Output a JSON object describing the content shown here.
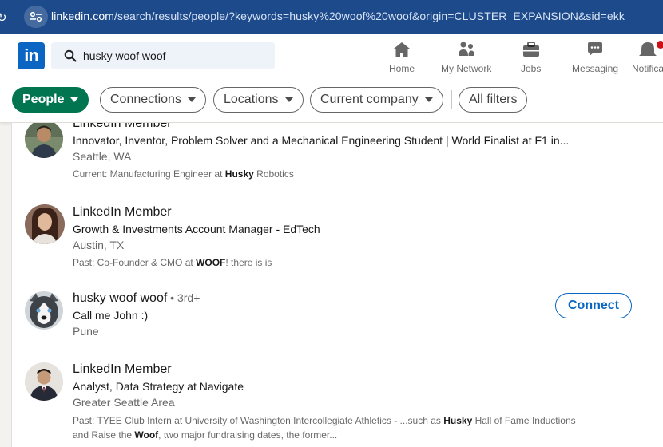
{
  "browser": {
    "url_host": "linkedin.com",
    "url_path": "/search/results/people/?keywords=husky%20woof%20woof&origin=CLUSTER_EXPANSION&sid=ekk"
  },
  "header": {
    "logo_text": "in",
    "search_value": "husky woof woof",
    "nav": [
      {
        "label": "Home",
        "icon": "home-icon"
      },
      {
        "label": "My Network",
        "icon": "network-icon"
      },
      {
        "label": "Jobs",
        "icon": "briefcase-icon"
      },
      {
        "label": "Messaging",
        "icon": "messaging-icon"
      },
      {
        "label": "Notifica",
        "icon": "bell-icon"
      }
    ]
  },
  "filters": [
    {
      "label": "People",
      "active": true
    },
    {
      "label": "Connections",
      "active": false
    },
    {
      "label": "Locations",
      "active": false
    },
    {
      "label": "Current company",
      "active": false
    },
    {
      "label": "All filters",
      "active": false
    }
  ],
  "results": [
    {
      "name": "LinkedIn Member",
      "headline": "Innovator, Inventor, Problem Solver and a Mechanical Engineering Student | World Finalist at F1 in...",
      "location": "Seattle, WA",
      "summary_prefix": "Current: Manufacturing Engineer at ",
      "summary_bold": "Husky",
      "summary_suffix": " Robotics"
    },
    {
      "name": "LinkedIn Member",
      "headline": "Growth & Investments Account Manager - EdTech",
      "location": "Austin, TX",
      "summary_prefix": "Past: Co-Founder & CMO at ",
      "summary_bold": "WOOF",
      "summary_suffix": "! there is is"
    },
    {
      "name": "husky woof woof",
      "degree": " • 3rd+",
      "headline": "Call me John :)",
      "location": "Pune",
      "action": "Connect"
    },
    {
      "name": "LinkedIn Member",
      "headline": "Analyst, Data Strategy at Navigate",
      "location": "Greater Seattle Area",
      "summary_p1": "Past: TYEE Club Intern at University of Washington Intercollegiate Athletics - ...such as ",
      "summary_b1": "Husky",
      "summary_p2": " Hall of Fame Inductions and Raise the ",
      "summary_b2": "Woof",
      "summary_p3": ", two major fundraising dates, the former..."
    }
  ],
  "colors": {
    "browser_bar": "#1d4a8a",
    "brand_blue": "#0a66c2",
    "active_pill": "#01754f"
  }
}
